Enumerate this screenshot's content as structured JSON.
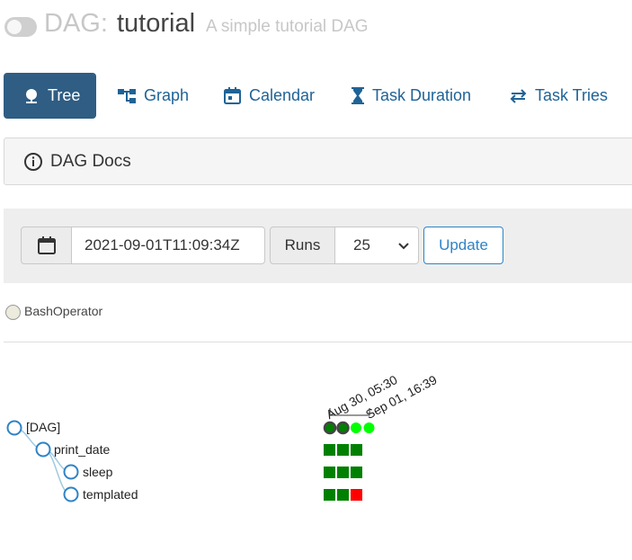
{
  "header": {
    "title_prefix": "DAG:",
    "dag_id": "tutorial",
    "description": "A simple tutorial DAG"
  },
  "nav": {
    "tabs": [
      {
        "label": "Tree",
        "icon": "tree-icon",
        "active": true
      },
      {
        "label": "Graph",
        "icon": "graph-icon"
      },
      {
        "label": "Calendar",
        "icon": "calendar-icon"
      },
      {
        "label": "Task Duration",
        "icon": "hourglass-icon"
      },
      {
        "label": "Task Tries",
        "icon": "retry-icon"
      }
    ]
  },
  "docs": {
    "label": "DAG Docs",
    "icon": "info-icon"
  },
  "controls": {
    "base_date": "2021-09-01T11:09:34Z",
    "runs_label": "Runs",
    "runs_value": "25",
    "update_label": "Update"
  },
  "legend": {
    "operators": [
      {
        "label": "BashOperator",
        "color": "#ecebdd"
      }
    ]
  },
  "tree": {
    "run_dates": [
      {
        "label": "Aug 30, 05:30"
      },
      {
        "label": "Sep 01, 16:39"
      }
    ],
    "nodes": [
      {
        "label": "[DAG]",
        "runs": [
          "success",
          "success",
          "running",
          "running"
        ]
      },
      {
        "label": "print_date",
        "runs": [
          "success",
          "success",
          "success"
        ]
      },
      {
        "label": "sleep",
        "runs": [
          "success",
          "success",
          "success"
        ]
      },
      {
        "label": "templated",
        "runs": [
          "success",
          "success",
          "failed"
        ]
      }
    ],
    "colors": {
      "success": "#008000",
      "running": "#00ff00",
      "failed": "#ff0000",
      "node_stroke": "#2f83c5",
      "link": "#9ecae1"
    }
  }
}
